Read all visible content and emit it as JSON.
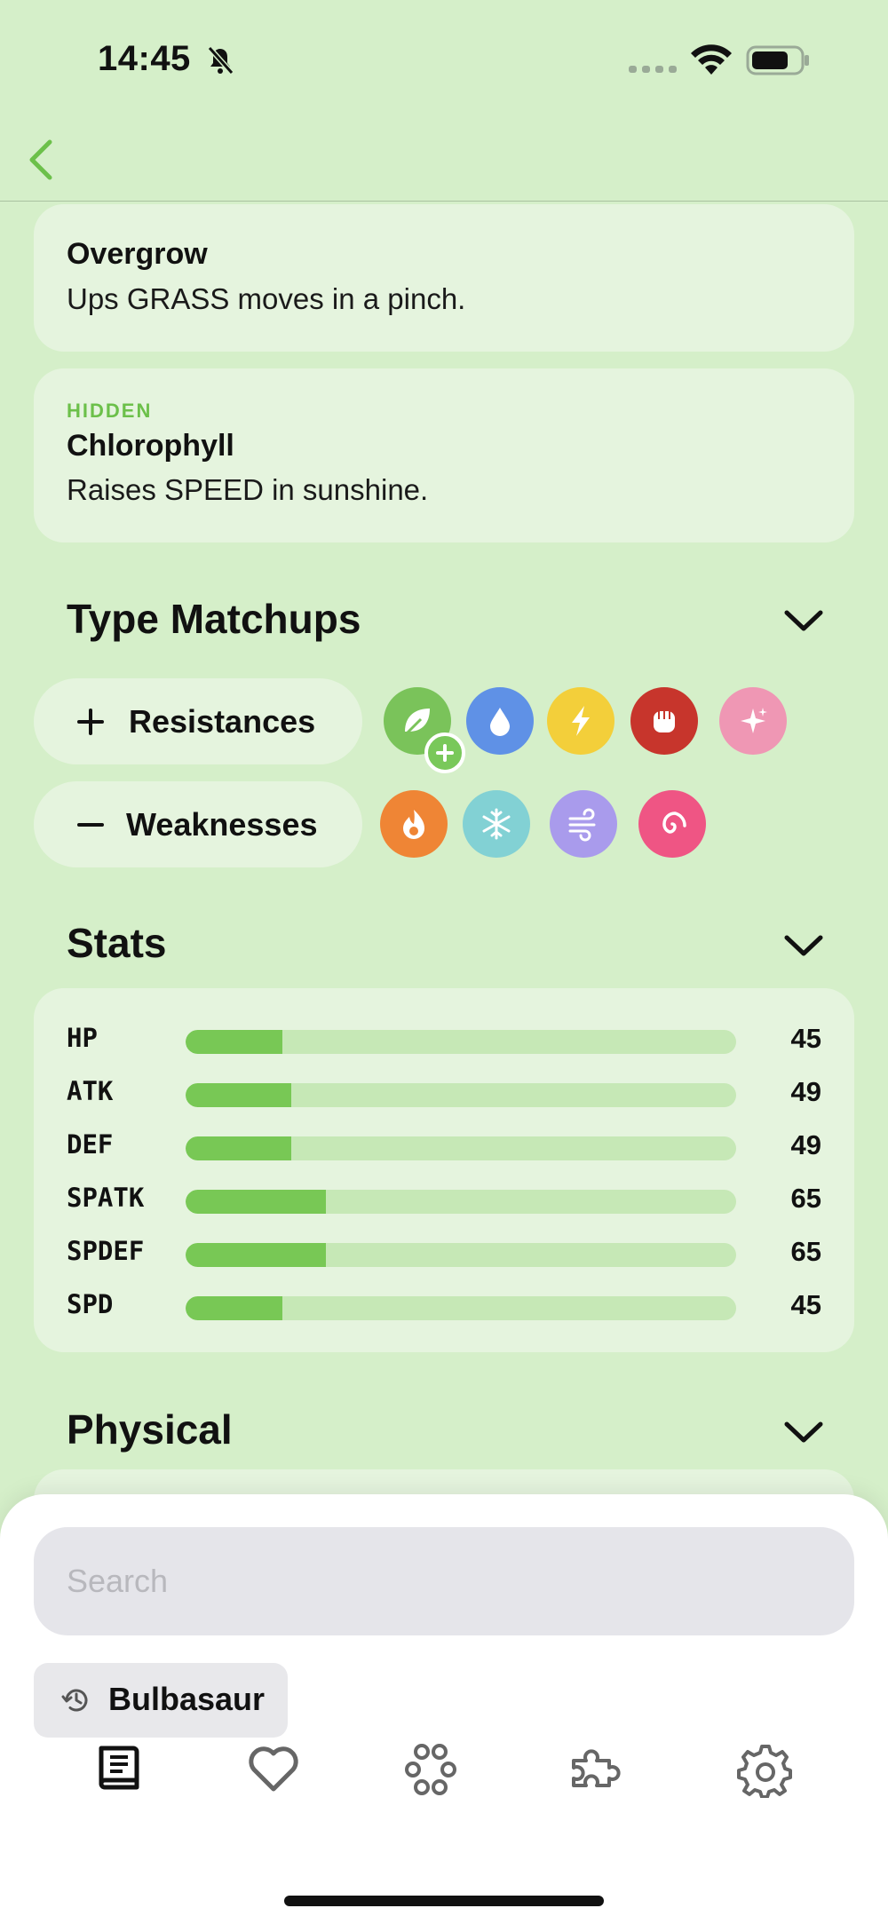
{
  "status_bar": {
    "time": "14:45"
  },
  "abilities": [
    {
      "tag": "",
      "name": "Overgrow",
      "description": "Ups GRASS moves in a pinch."
    },
    {
      "tag": "HIDDEN",
      "name": "Chlorophyll",
      "description": "Raises SPEED in sunshine."
    }
  ],
  "type_matchups": {
    "title": "Type Matchups",
    "resistances_label": "Resistances",
    "weaknesses_label": "Weaknesses",
    "resistances": [
      {
        "type": "grass",
        "color": "#7ac35a",
        "icon": "leaf-icon",
        "double": true
      },
      {
        "type": "water",
        "color": "#5f91e6",
        "icon": "water-drop-icon"
      },
      {
        "type": "electric",
        "color": "#f3cf3a",
        "icon": "lightning-icon"
      },
      {
        "type": "fighting",
        "color": "#c7352c",
        "icon": "fist-icon"
      },
      {
        "type": "fairy",
        "color": "#ef97b4",
        "icon": "sparkle-icon"
      }
    ],
    "weaknesses": [
      {
        "type": "fire",
        "color": "#ef8535",
        "icon": "flame-icon"
      },
      {
        "type": "ice",
        "color": "#82d1d4",
        "icon": "snowflake-icon"
      },
      {
        "type": "flying",
        "color": "#a99bec",
        "icon": "wind-icon"
      },
      {
        "type": "psychic",
        "color": "#ef5584",
        "icon": "spiral-icon"
      }
    ]
  },
  "stats": {
    "title": "Stats",
    "max_value": 255,
    "items": [
      {
        "label": "HP",
        "value": 45
      },
      {
        "label": "ATK",
        "value": 49
      },
      {
        "label": "DEF",
        "value": 49
      },
      {
        "label": "SPATK",
        "value": 65
      },
      {
        "label": "SPDEF",
        "value": 65
      },
      {
        "label": "SPD",
        "value": 45
      }
    ]
  },
  "physical": {
    "title": "Physical"
  },
  "search": {
    "placeholder": "Search"
  },
  "recent": {
    "label": "Bulbasaur"
  },
  "tabs": [
    "book-icon",
    "heart-icon",
    "pokeballs-icon",
    "puzzle-icon",
    "settings-gear-icon"
  ],
  "colors": {
    "accent": "#6cc04a",
    "background": "#d5efc9",
    "card": "#e5f4de",
    "bar_fill": "#78c855",
    "bar_track": "#c6e8b6"
  }
}
